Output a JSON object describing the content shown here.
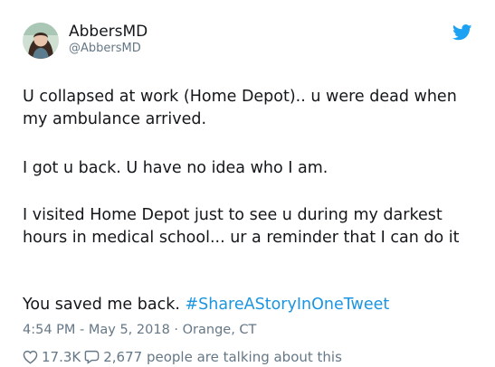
{
  "author": {
    "name": "AbbersMD",
    "handle": "@AbbersMD"
  },
  "tweet": {
    "paragraph_1": "U collapsed at work (Home Depot).. u were dead when my ambulance arrived.",
    "paragraph_2": "I got u back. U have no idea who I am.",
    "paragraph_3": "I visited Home Depot just to see u during my darkest hours in medical school... ur a reminder that I can do it",
    "paragraph_4_text": "You saved me back.",
    "hashtag": "#ShareAStoryInOneTweet"
  },
  "meta": {
    "timestamp": "4:54 PM - May 5, 2018 · Orange, CT"
  },
  "actions": {
    "likes": "17.3K",
    "replies_text": "2,677 people are talking about this"
  },
  "colors": {
    "text": "#14171a",
    "secondary": "#657786",
    "accent": "#1b95e0",
    "twitter_blue": "#1da1f2"
  },
  "icons": {
    "brand": "twitter-bird-icon",
    "like": "heart-icon",
    "reply": "speech-bubble-icon"
  }
}
